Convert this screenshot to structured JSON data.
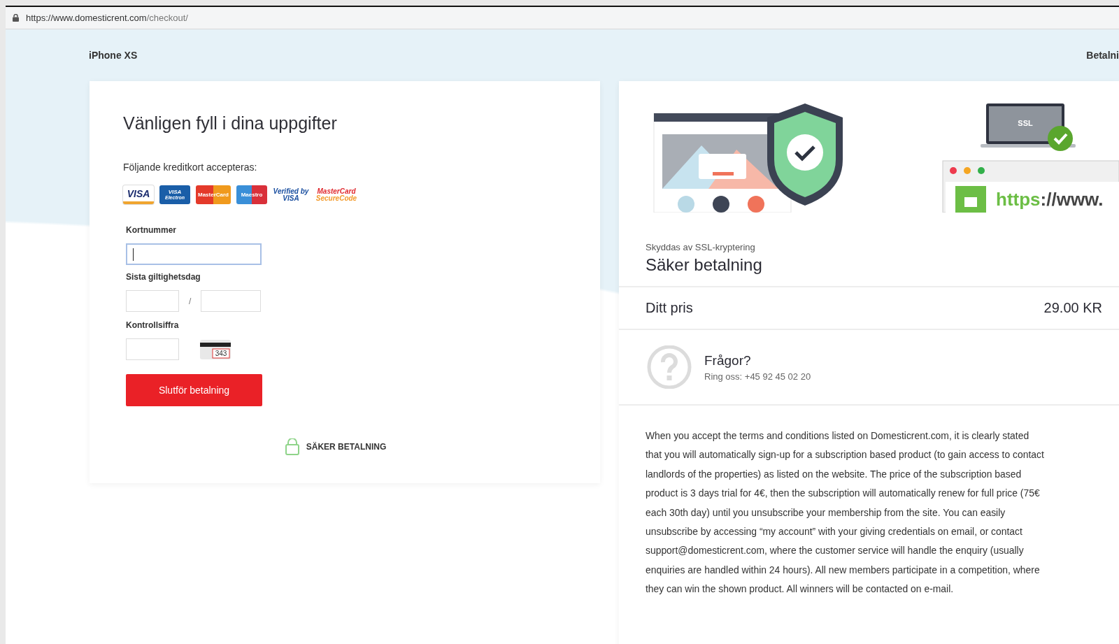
{
  "browser": {
    "url_host": "https://www.domesticrent.com",
    "url_path": "/checkout/"
  },
  "header": {
    "product": "iPhone XS",
    "step": "Betalni"
  },
  "form": {
    "title": "Vänligen fyll i dina uppgifter",
    "cards_label": "Följande kreditkort accepteras:",
    "card_logos": [
      {
        "kind": "visa",
        "label": "VISA"
      },
      {
        "kind": "electron",
        "label": "VISA",
        "sublabel": "Electron"
      },
      {
        "kind": "mastercard",
        "label": "MasterCard"
      },
      {
        "kind": "maestro",
        "label": "Maestro"
      },
      {
        "kind": "verified",
        "label": "Verified by",
        "sublabel": "VISA"
      },
      {
        "kind": "securecode",
        "label": "MasterCard",
        "sublabel": "SecureCode"
      }
    ],
    "card_number": {
      "label": "Kortnummer",
      "focused": true
    },
    "expiry": {
      "label": "Sista giltighetsdag",
      "separator": "/"
    },
    "cvc": {
      "label": "Kontrollsiffra",
      "hint": "343"
    },
    "submit": "Slutför betalning",
    "secure_note": "SÄKER BETALNING"
  },
  "summary": {
    "illustration": {
      "ssl": "SSL",
      "url_scheme": "https",
      "url_rest": "://www."
    },
    "subtitle": "Skyddas av SSL-kryptering",
    "title": "Säker betalning",
    "price_label": "Ditt pris",
    "price": "29.00 KR",
    "questions_title": "Frågor?",
    "questions_phone": "Ring oss: +45 92 45 02 20",
    "terms": "When you accept the terms and conditions listed on Domesticrent.com, it is clearly stated that you will automatically sign-up for a subscription based product (to gain access to contact landlords of the properties) as listed on the website. The price of the subscription based product is 3 days trial for 4€, then the subscription will automatically renew for full price (75€ each 30th day) until you unsubscribe your membership from the site. You can easily unsubscribe by accessing “my account” with your giving credentials on email, or contact support@domesticrent.com, where the customer service will handle the enquiry (usually enquiries are handled within 24 hours). All new members participate in a competition, where they can win the shown product. All winners will be contacted on e-mail."
  }
}
